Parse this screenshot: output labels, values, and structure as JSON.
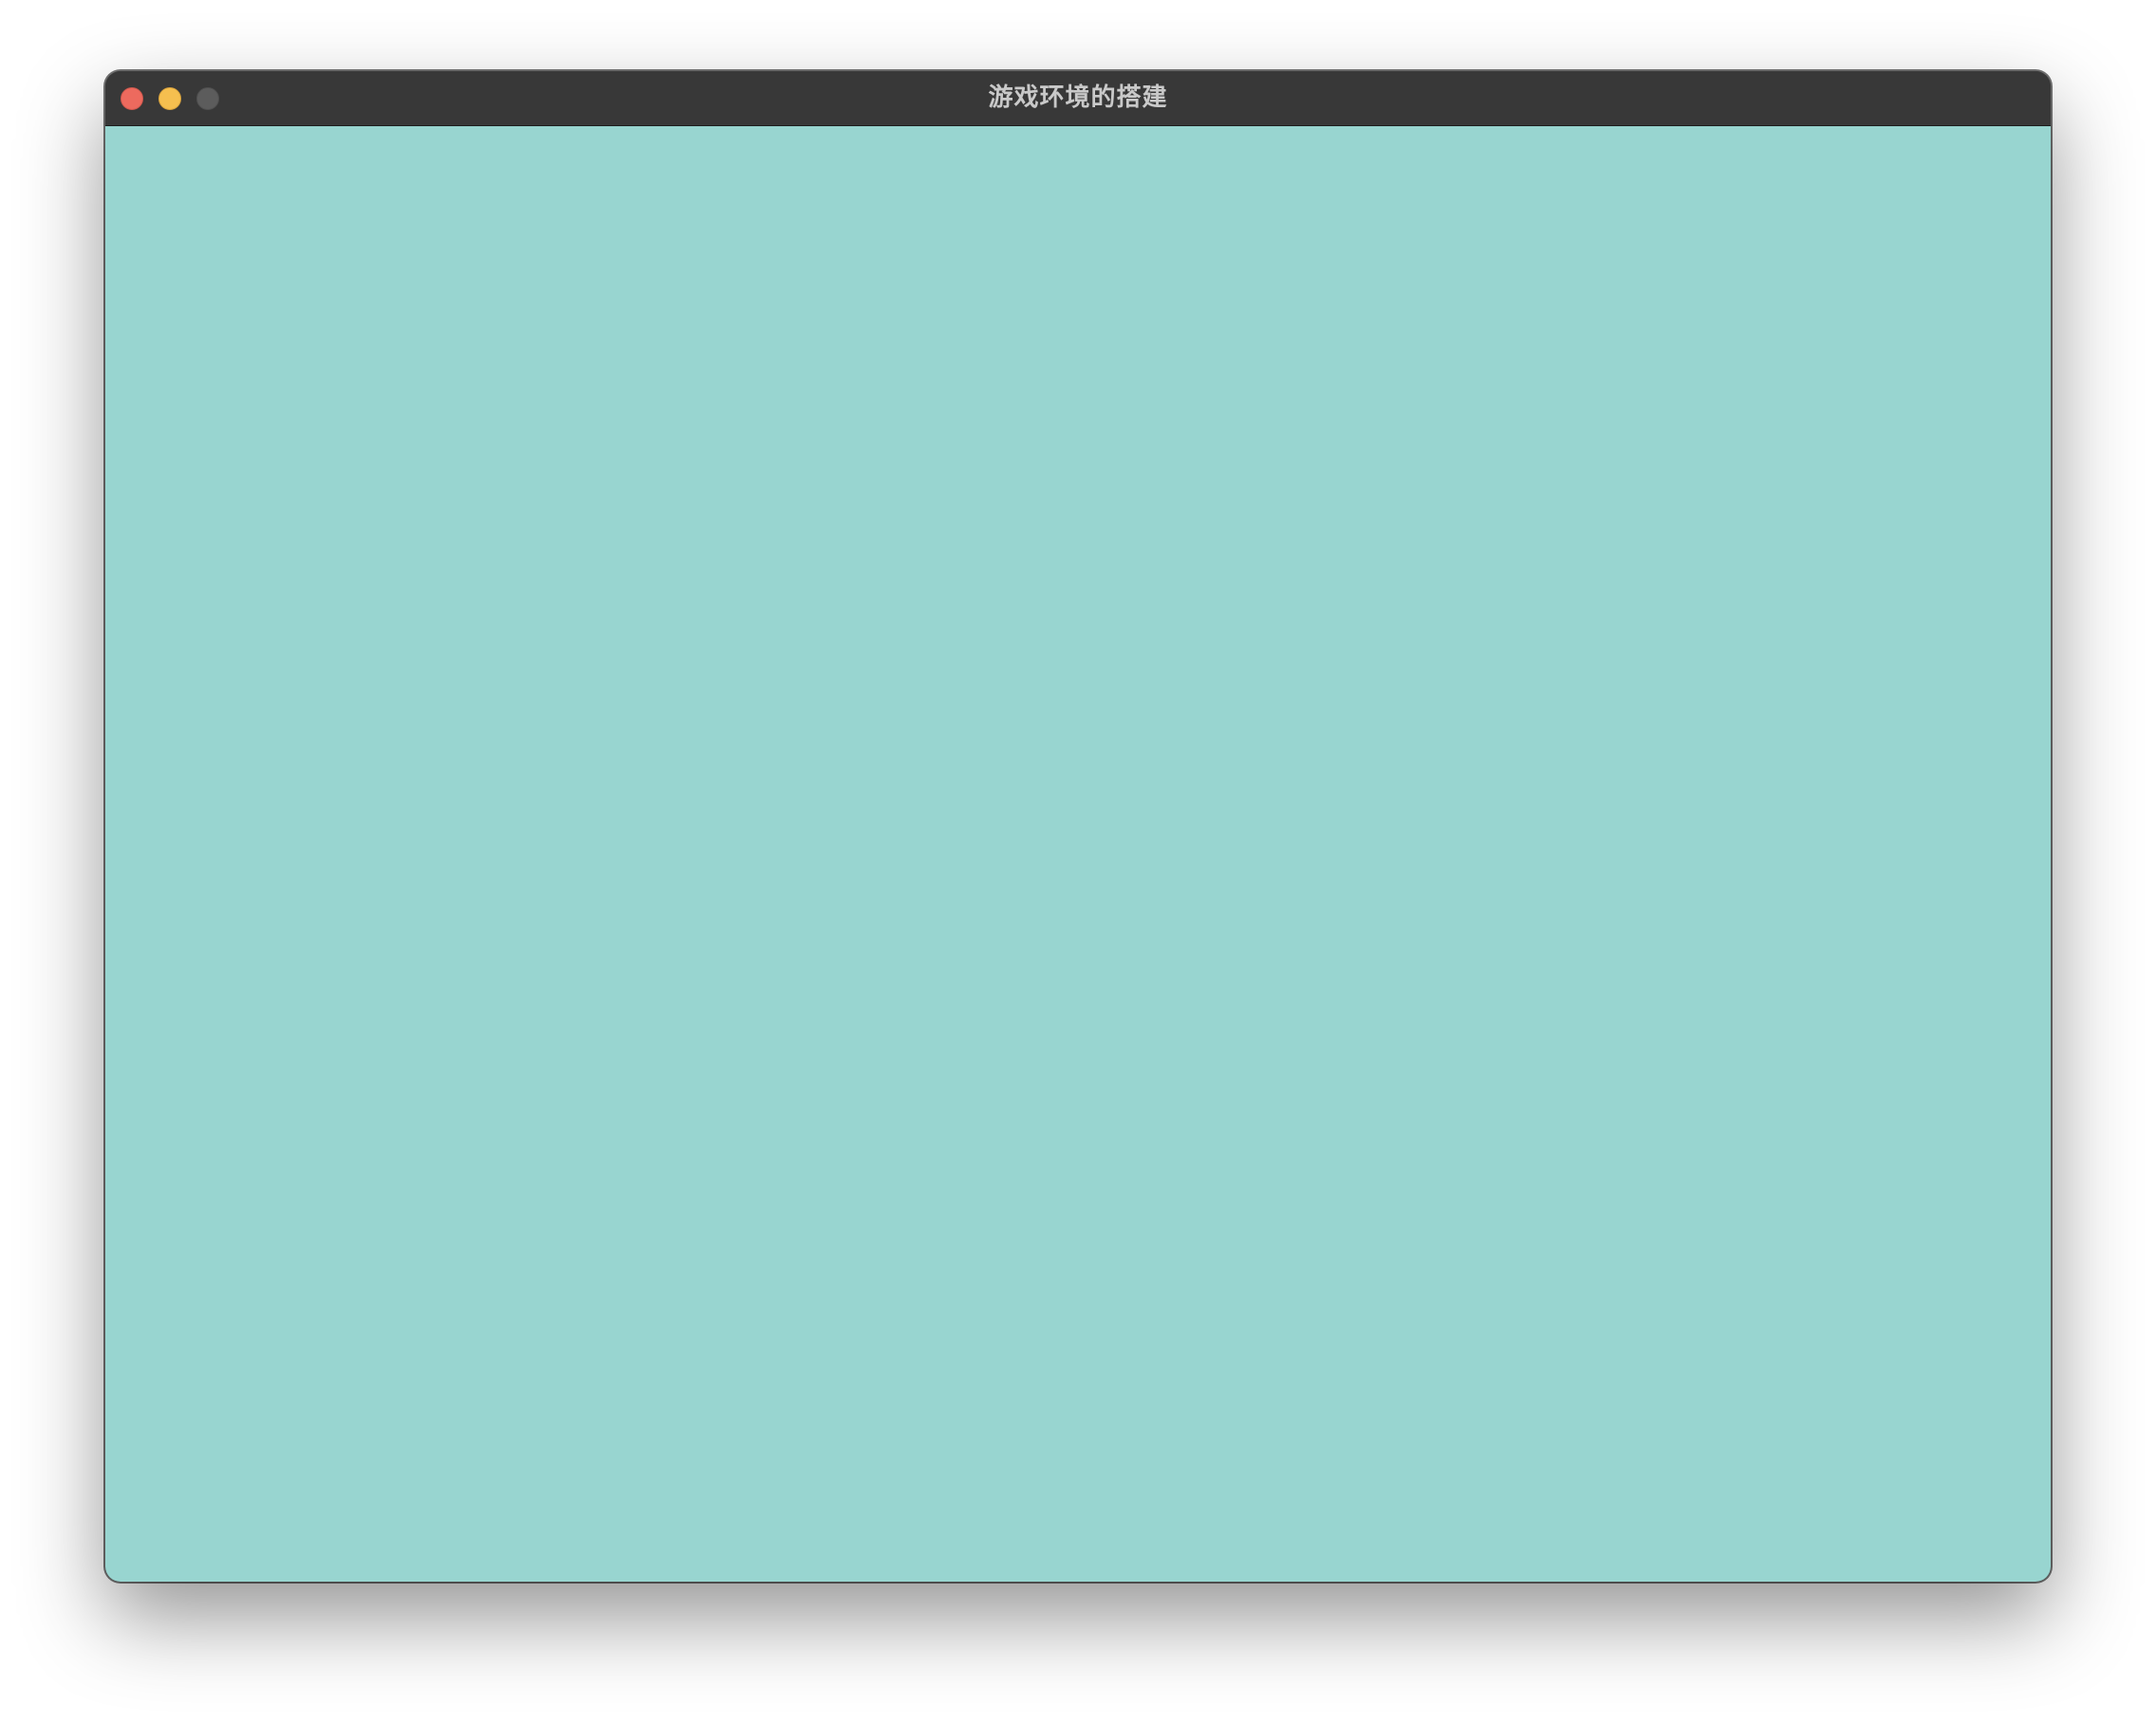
{
  "window": {
    "title": "游戏环境的搭建",
    "controls": {
      "close_icon": "close-icon",
      "minimize_icon": "minimize-icon",
      "zoom_icon": "zoom-icon"
    }
  },
  "canvas": {
    "background_color": "#98d5d0"
  },
  "colors": {
    "titlebar": "#383838",
    "title_text": "#c9c9c9",
    "close": "#ed6a5e",
    "minimize": "#f5bf4f",
    "zoom": "#5c5c5c"
  }
}
